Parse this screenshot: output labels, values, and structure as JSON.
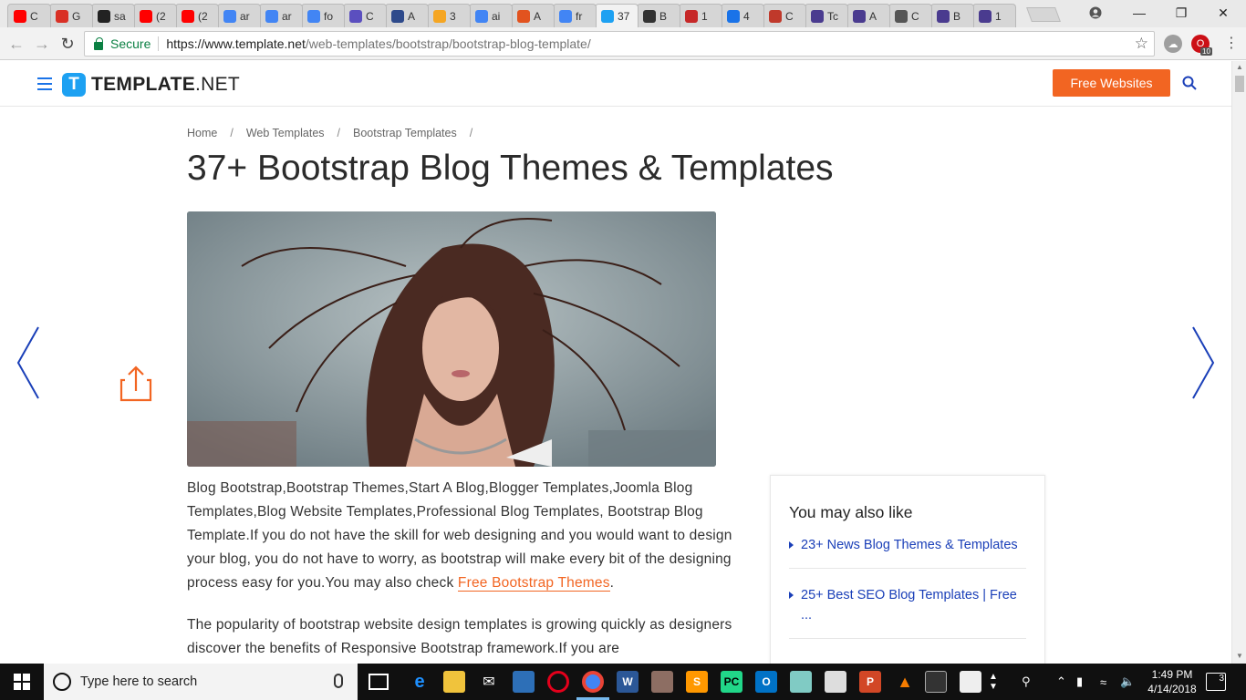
{
  "browser": {
    "tabs": [
      {
        "label": "C",
        "fav": "youtube-icon",
        "color": "#ff0000"
      },
      {
        "label": "G",
        "fav": "gmail-icon",
        "color": "#d93025"
      },
      {
        "label": "sa",
        "fav": "github-icon",
        "color": "#222222"
      },
      {
        "label": "(2",
        "fav": "youtube-icon",
        "color": "#ff0000"
      },
      {
        "label": "(2",
        "fav": "youtube-icon",
        "color": "#ff0000"
      },
      {
        "label": "ar",
        "fav": "google-icon",
        "color": "#4285f4"
      },
      {
        "label": "ar",
        "fav": "google-icon",
        "color": "#4285f4"
      },
      {
        "label": "fo",
        "fav": "google-icon",
        "color": "#4285f4"
      },
      {
        "label": "C",
        "fav": "code-icon",
        "color": "#5b4fbf"
      },
      {
        "label": "A",
        "fav": "s-logo-icon",
        "color": "#2e4a8b"
      },
      {
        "label": "3",
        "fav": "her-icon",
        "color": "#f5a623"
      },
      {
        "label": "ai",
        "fav": "google-icon",
        "color": "#4285f4"
      },
      {
        "label": "A",
        "fav": "flame-icon",
        "color": "#e2531f"
      },
      {
        "label": "fr",
        "fav": "google-icon",
        "color": "#4285f4"
      },
      {
        "label": "37",
        "fav": "template-icon",
        "color": "#1da1f2"
      },
      {
        "label": "B",
        "fav": "b-logo-icon",
        "color": "#333333"
      },
      {
        "label": "1",
        "fav": "circles-icon",
        "color": "#c62828"
      },
      {
        "label": "4",
        "fav": "spinner-icon",
        "color": "#1a73e8"
      },
      {
        "label": "C",
        "fav": "s-red-icon",
        "color": "#c0392b"
      },
      {
        "label": "Tc",
        "fav": "colorlib-icon",
        "color": "#4a3b8f"
      },
      {
        "label": "A",
        "fav": "colorlib-icon",
        "color": "#4a3b8f"
      },
      {
        "label": "C",
        "fav": "wordpress-icon",
        "color": "#555555"
      },
      {
        "label": "B",
        "fav": "colorlib-icon",
        "color": "#4a3b8f"
      },
      {
        "label": "1",
        "fav": "colorlib-icon",
        "color": "#4a3b8f"
      }
    ],
    "secure_label": "Secure",
    "url_host": "https://www.template.net",
    "url_path": "/web-templates/bootstrap/bootstrap-blog-template/",
    "ext_badge": "10"
  },
  "site": {
    "logo_letter": "T",
    "logo_bold": "TEMPLATE",
    "logo_rest": ".NET",
    "cta_label": "Free Websites",
    "breadcrumb": [
      "Home",
      "Web Templates",
      "Bootstrap Templates"
    ],
    "title": "37+ Bootstrap Blog Themes & Templates",
    "paragraph1": "Blog Bootstrap,Bootstrap Themes,Start A Blog,Blogger Templates,Joomla Blog Templates,Blog  Website Templates,Professional Blog Templates, Bootstrap Blog Template.If you do not have the skill for web designing and you would want to design your blog, you do not have to worry, as bootstrap will make every bit of the designing process easy for you.You may also check ",
    "paragraph1_link": "Free Bootstrap Themes",
    "paragraph1_end": ".",
    "paragraph2": "The popularity of bootstrap website design templates is growing quickly as designers discover the benefits of Responsive Bootstrap framework.If you are",
    "aside_title": "You may also like",
    "aside_items": [
      "23+ News Blog Themes & Templates",
      "25+ Best SEO Blog Templates | Free ..."
    ]
  },
  "taskbar": {
    "search_placeholder": "Type here to search",
    "time": "1:49 PM",
    "date": "4/14/2018",
    "notifications": "3"
  }
}
